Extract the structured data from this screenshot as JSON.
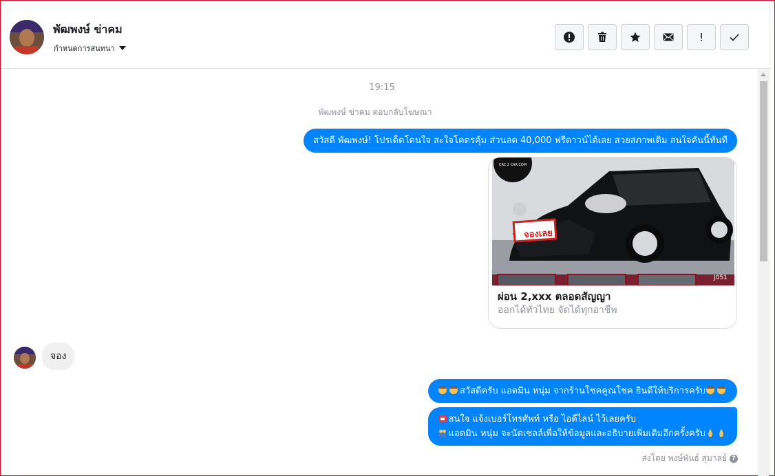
{
  "header": {
    "contact_name": "พัฒพงษ์ ข่าคม",
    "assign_label": "กำหนดการสนทนา"
  },
  "toolbar": {
    "buttons": [
      {
        "name": "report-button",
        "icon": "exclamation-circle-icon"
      },
      {
        "name": "delete-button",
        "icon": "trash-icon"
      },
      {
        "name": "star-button",
        "icon": "star-icon"
      },
      {
        "name": "mark-unread-button",
        "icon": "envelope-icon"
      },
      {
        "name": "follow-up-button",
        "icon": "exclamation-icon",
        "label": "!"
      },
      {
        "name": "mark-done-button",
        "icon": "checkmark-icon"
      }
    ]
  },
  "thread": {
    "time": "19:15",
    "reply_note": "พัฒพงษ์ ข่าคม ตอบกลับโฆษณา",
    "ad_message": "สวัสดี พัฒพงษ์! โปรเด็ดโดนใจ สะใจโคตรคุ้ม ส่วนลด 40,000 ฟรีดาวน์ได้เลย สวยสภาพเดิม สนใจคันนี้ทันที",
    "ad_card": {
      "image_stamp": "จองเลย",
      "image_code": "J051",
      "image_logo": "CRC 2 CAR.COM",
      "title": "ผ่อน 2,xxx ตลอดสัญญา",
      "subtitle": "ออกได้ทั่วไทย จัดได้ทุกอาชีพ"
    },
    "incoming_message": "จอง",
    "reply_1": "สวัสดีครับ แอดมิน หนุ่ม จากร้านโชคคูณโชค ยินดีให้บริการครับ",
    "reply_2_line1": "สนใจ แจ้งเบอร์โทรศัพท์ หรือ ไอดีไลน์  ไว้เลยครับ",
    "reply_2_line2": "แอดมิน หนุ่ม จะนัดเซลล์เพื่อให้ข้อมูลและอธิบายเพิ่มเติมอีกครั้งครับ",
    "sent_by": "ส่งโดย พงษ์พันธ์ สุมาลย์"
  },
  "colors": {
    "outgoing_bubble": "#0084ff",
    "incoming_bubble": "#f1f0f0",
    "muted_text": "#90949c"
  }
}
